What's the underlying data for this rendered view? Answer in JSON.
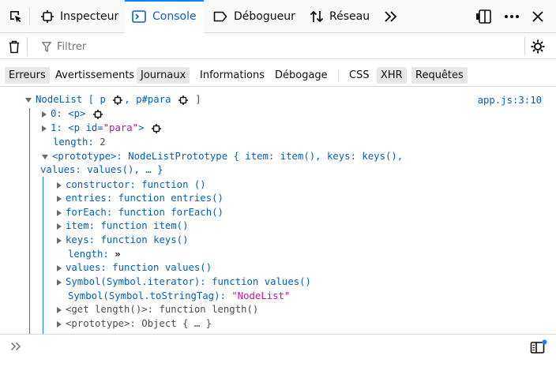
{
  "toolbar": {
    "tabs": [
      {
        "id": "inspector",
        "label": "Inspecteur",
        "icon": "inspector-icon"
      },
      {
        "id": "console",
        "label": "Console",
        "icon": "console-icon",
        "active": true
      },
      {
        "id": "debugger",
        "label": "Débogueur",
        "icon": "debugger-icon"
      },
      {
        "id": "network",
        "label": "Réseau",
        "icon": "network-icon"
      }
    ],
    "more_tabs_icon": "double-chevron-icon",
    "right_icons": [
      "dock-icon",
      "overflow-menu-icon",
      "close-icon"
    ]
  },
  "filter": {
    "placeholder": "Filtrer"
  },
  "categories": [
    {
      "label": "Erreurs",
      "checked": true
    },
    {
      "label": "Avertissements",
      "checked": false
    },
    {
      "label": "Journaux",
      "checked": true
    },
    {
      "label": "Informations",
      "checked": false
    },
    {
      "label": "Débogage",
      "checked": false
    },
    {
      "label": "CSS",
      "checked": false
    },
    {
      "label": "XHR",
      "checked": true
    },
    {
      "label": "Requêtes",
      "checked": true
    }
  ],
  "output": {
    "source_location": "app.js:3:10",
    "header": {
      "prefix": "NodeList [ ",
      "item1": "p",
      "sep": ", ",
      "item2": "p#para",
      "suffix": " ]"
    },
    "entries": [
      {
        "key": "0:",
        "value": "<p>"
      },
      {
        "key": "1:",
        "value_open": "<p ",
        "attr_name": "id",
        "attr_eq": "=",
        "attr_value": "\"para\"",
        "value_close": ">"
      }
    ],
    "length_line": {
      "key": "length:",
      "value": "2"
    },
    "prototype_line1": "<prototype>: NodeListPrototype { item: item(), keys: keys(),",
    "prototype_line2": "values: values(), … }",
    "proto_members": [
      {
        "key": "constructor:",
        "value": "function ()"
      },
      {
        "key": "entries:",
        "value": "function entries()"
      },
      {
        "key": "forEach:",
        "value": "function forEach()"
      },
      {
        "key": "item:",
        "value": "function item()"
      },
      {
        "key": "keys:",
        "value": "function keys()"
      }
    ],
    "length_getter": {
      "key": "length:",
      "value": "»"
    },
    "values_member": {
      "key": "values:",
      "value": "function values()"
    },
    "iterator_member": {
      "key": "Symbol(Symbol.iterator):",
      "value": "function values()"
    },
    "tostringtag": {
      "key": "Symbol(Symbol.toStringTag):",
      "value": "\"NodeList\""
    },
    "getter_line": {
      "key": "<get length()>:",
      "value": "function length()"
    },
    "proto_proto": {
      "key": "<prototype>:",
      "value": "Object { … }"
    }
  },
  "input": {
    "prompt_icon": "double-chevron-prompt-icon",
    "editor_toggle_icon": "editor-mode-icon"
  }
}
